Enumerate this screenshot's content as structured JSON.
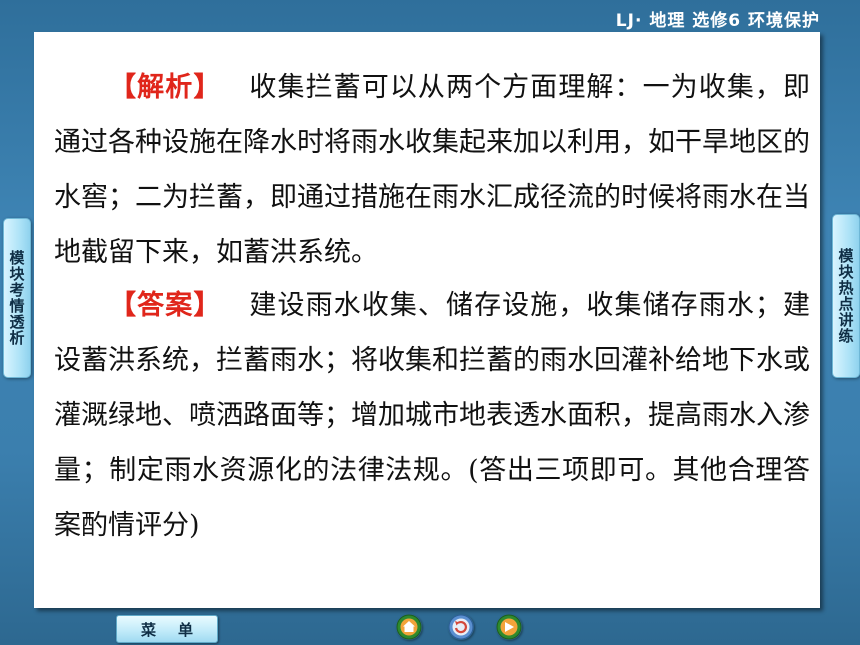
{
  "header": {
    "title": "LJ· 地理  选修6  环境保护"
  },
  "left_tab": {
    "label": "模块考情透析"
  },
  "right_tab": {
    "label": "模块热点讲练"
  },
  "analysis": {
    "tag": "【解析】",
    "text": "收集拦蓄可以从两个方面理解：一为收集，即通过各种设施在降水时将雨水收集起来加以利用，如干旱地区的水窖；二为拦蓄，即通过措施在雨水汇成径流的时候将雨水在当地截留下来，如蓄洪系统。"
  },
  "answer": {
    "tag": "【答案】",
    "text": "建设雨水收集、储存设施，收集储存雨水；建设蓄洪系统，拦蓄雨水；将收集和拦蓄的雨水回灌补给地下水或灌溉绿地、喷洒路面等；增加城市地表透水面积，提高雨水入渗量；制定雨水资源化的法律法规。(答出三项即可。其他合理答案酌情评分)"
  },
  "footer": {
    "menu_label": "菜单"
  },
  "icons": [
    "home-icon",
    "refresh-icon",
    "forward-icon"
  ],
  "colors": {
    "tag_red": "#e0261b",
    "background_blue": "#3b7fae"
  }
}
